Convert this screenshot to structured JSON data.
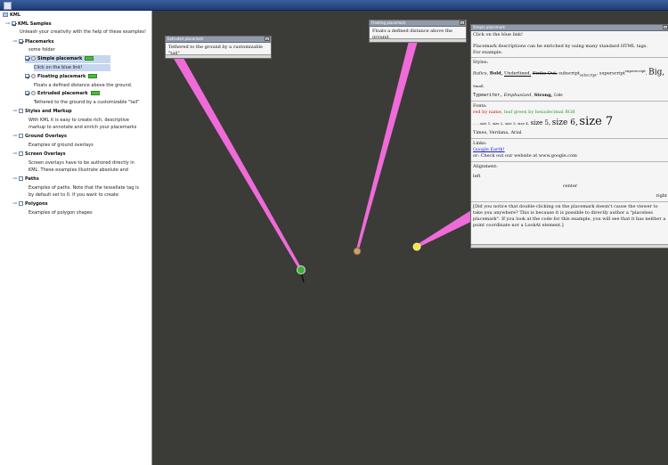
{
  "window": {
    "title": ""
  },
  "tree": {
    "root_label": "KML",
    "samples_label": "KML Samples",
    "samples_desc": "Unleash your creativity with the help of these examples!",
    "placemarks_label": "Placemarks",
    "some_folder": "some folder",
    "simple_label": "Simple placemark",
    "simple_desc": "Click on the blue link!",
    "floating_label": "Floating placemark",
    "floating_desc": "Floats a defined distance above the ground.",
    "extruded_label": "Extruded placemark",
    "extruded_desc": "Tethered to the ground by a customizable \"tail\"",
    "styles_label": "Styles and Markup",
    "styles_desc1": "With KML it is easy to create rich, descriptive",
    "styles_desc2": "markup to annotate and enrich your placemarks",
    "ground_label": "Ground Overlays",
    "ground_desc": "Examples of ground overlays",
    "screen_label": "Screen Overlays",
    "screen_desc1": "Screen overlays have to be authored directly in",
    "screen_desc2": "KML. These examples illustrate absolute and",
    "paths_label": "Paths",
    "paths_desc1": "Examples of paths. Note that the tessellate tag is",
    "paths_desc2": "by default set to 0. If you want to create",
    "polygons_label": "Polygons",
    "polygons_desc": "Examples of polygon shapes"
  },
  "balloons": {
    "extruded_title": "Extruded placemark",
    "extruded_text": "Tethered to the ground by a customizable \"tail\"",
    "floating_title": "Floating placemark",
    "floating_text": "Floats a defined distance above the ground.",
    "simple_title": "Simple placemark",
    "simple": {
      "line1": "Click on the blue link!",
      "line2": "Placemark descriptions can be enriched by using many standard HTML tags.",
      "line3": "For example:",
      "styles_head": "Styles:",
      "styles_italics": "Italics,",
      "styles_bold": "Bold,",
      "styles_underlined": "Underlined,",
      "styles_strike": "Strike Out,",
      "styles_subscript": "subscript",
      "styles_sub": "subscript",
      "styles_superscript": "superscript",
      "styles_sup": "superscript",
      "styles_big": "Big,",
      "styles_small": "Small,",
      "styles_typewriter": "Typewriter,",
      "styles_emphasized": "Emphasized,",
      "styles_strong": "Strong,",
      "styles_code": "Code",
      "fonts_head": "Fonts:",
      "fonts_red": "red by name,",
      "fonts_green": "leaf green by hexadecimal RGB",
      "fonts_sizes_small": "... , size 1, size 2, size 3, size 4,",
      "fonts_size5": "size 5,",
      "fonts_size6": "size 6,",
      "fonts_size7": "size 7",
      "fonts_faces": "Times, Verdana, Arial",
      "links_head": "Links:",
      "links_link": "Google Earth!",
      "links_text": "or: Check out our website at www.google.com",
      "align_head": "Alignment:",
      "align_left": "left",
      "align_center": "center",
      "align_right": "right",
      "footer": "[Did you notice that double-clicking on the placemark doesn't cause the viewer to take you anywhere? This is because it is possible to directly author a \"placeless placemark\". If you look at the code for this example, you will see that it has neither a point coordinate nor a LookAt element.]"
    }
  },
  "colors": {
    "map_bg": "#3b3b38",
    "tether": "#ef6bd8",
    "pin_green": "#3fae3a",
    "pin_tan": "#c7a36f",
    "pin_yellow": "#f2e83a"
  }
}
